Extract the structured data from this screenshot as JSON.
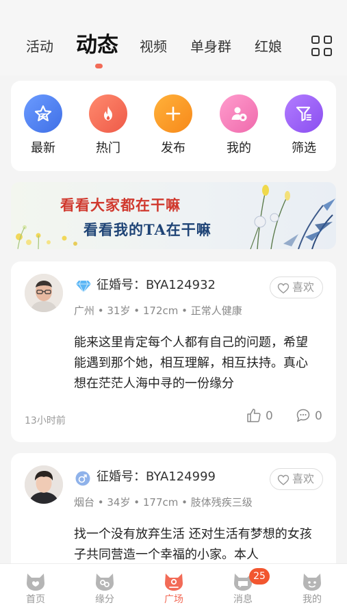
{
  "top_tabs": [
    {
      "label": "活动"
    },
    {
      "label": "动态",
      "active": true
    },
    {
      "label": "视频"
    },
    {
      "label": "单身群"
    },
    {
      "label": "红娘"
    }
  ],
  "quick_menu": [
    {
      "label": "最新",
      "icon": "star-icon",
      "color": "#4f7ff0"
    },
    {
      "label": "热门",
      "icon": "flame-icon",
      "color": "#f26b57"
    },
    {
      "label": "发布",
      "icon": "plus-icon",
      "color": "#f7971e"
    },
    {
      "label": "我的",
      "icon": "user-star-icon",
      "color": "#f47ab8"
    },
    {
      "label": "筛选",
      "icon": "filter-icon",
      "color": "#9b5cf0"
    }
  ],
  "banner": {
    "line1": "看看大家都在干嘛",
    "line2": "看看我的TA在干嘛"
  },
  "posts": [
    {
      "id_label": "征婚号：BYA124932",
      "badge": "diamond-icon",
      "info": "广州 • 31岁 • 172cm • 正常人健康",
      "like_label": "喜欢",
      "text": "能来这里肯定每个人都有自己的问题，希望能遇到那个她，相互理解，相互扶持。真心想在茫茫人海中寻的一份缘分",
      "time": "13小时前",
      "likes": "0",
      "comments": "0"
    },
    {
      "id_label": "征婚号：BYA124999",
      "badge": "male-icon",
      "info": "烟台 • 34岁 • 177cm • 肢体残疾三级",
      "like_label": "喜欢",
      "text": "找一个没有放弃生活 还对生活有梦想的女孩子共同营造一个幸福的小家。本人"
    }
  ],
  "bottom_nav": [
    {
      "label": "首页"
    },
    {
      "label": "缘分"
    },
    {
      "label": "广场",
      "active": true
    },
    {
      "label": "消息",
      "badge": "25"
    },
    {
      "label": "我的"
    }
  ],
  "colors": {
    "accent": "#f26b57",
    "background": "#f4f4f4"
  }
}
